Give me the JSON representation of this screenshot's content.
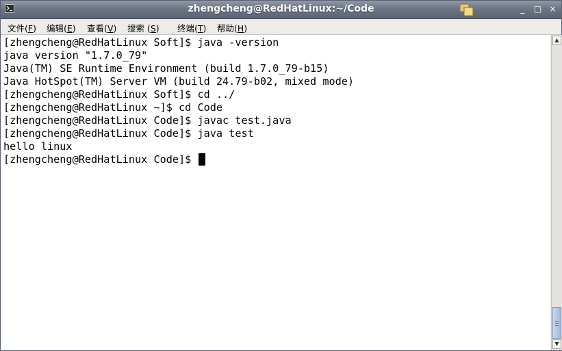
{
  "window": {
    "title": "zhengcheng@RedHatLinux:~/Code",
    "app_icon": "terminal-icon",
    "controls": {
      "minimize": "_",
      "maximize": "□",
      "close": "×"
    }
  },
  "menu": {
    "items": [
      {
        "label_pre": "文件(",
        "mnemonic": "F",
        "label_post": ")"
      },
      {
        "label_pre": "编辑(",
        "mnemonic": "E",
        "label_post": ")"
      },
      {
        "label_pre": "查看(",
        "mnemonic": "V",
        "label_post": ")"
      },
      {
        "label_pre": "搜索 (",
        "mnemonic": "S",
        "label_post": ")"
      },
      {
        "label_pre": "终端(",
        "mnemonic": "T",
        "label_post": ")"
      },
      {
        "label_pre": "帮助(",
        "mnemonic": "H",
        "label_post": ")"
      }
    ]
  },
  "terminal": {
    "lines": [
      "[zhengcheng@RedHatLinux Soft]$ java -version",
      "java version \"1.7.0_79\"",
      "Java(TM) SE Runtime Environment (build 1.7.0_79-b15)",
      "Java HotSpot(TM) Server VM (build 24.79-b02, mixed mode)",
      "[zhengcheng@RedHatLinux Soft]$ cd ../",
      "[zhengcheng@RedHatLinux ~]$ cd Code",
      "[zhengcheng@RedHatLinux Code]$ javac test.java",
      "[zhengcheng@RedHatLinux Code]$ java test",
      "hello linux"
    ],
    "prompt": "[zhengcheng@RedHatLinux Code]$ "
  },
  "colors": {
    "titlebar": "#6c7584",
    "terminal_bg": "#ffffff",
    "terminal_fg": "#000000",
    "scroll_thumb": "#a9c0e0"
  }
}
